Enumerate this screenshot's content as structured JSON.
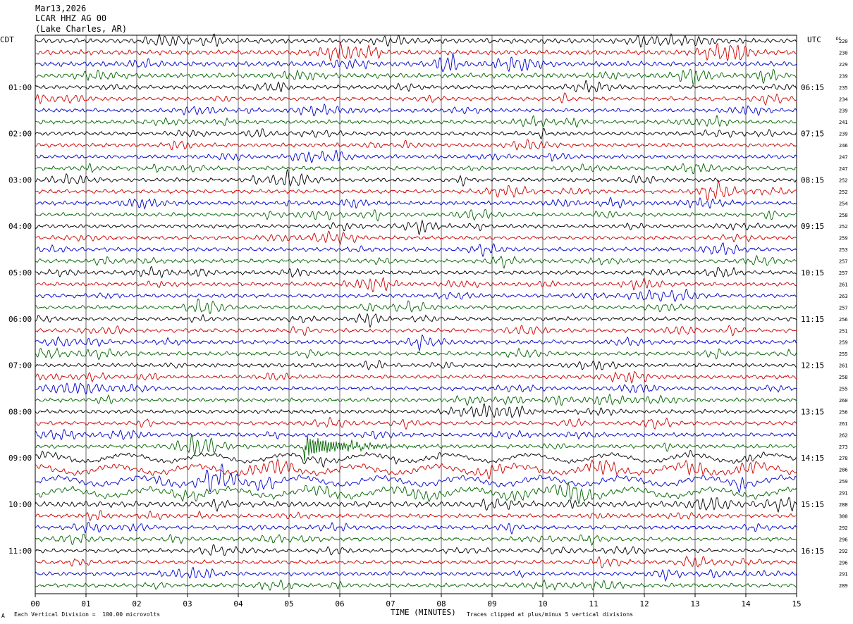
{
  "header": {
    "date": "Mar13,2026",
    "station": "LCAR HHZ AG 00",
    "location": "(Lake Charles, AR)"
  },
  "left_tz": "CDT",
  "right_tz": "UTC",
  "dc_label": "DC",
  "footer": {
    "scale_note": "Each Vertical Division =  100.00 microvolts",
    "clip_note": "Traces clipped at plus/minus 5 vertical divisions",
    "corner_mark": "A"
  },
  "chart_data": {
    "type": "line",
    "title": "",
    "xlabel": "TIME (MINUTES)",
    "ylabel": "",
    "xlim": [
      0,
      15
    ],
    "x_ticks": [
      "00",
      "01",
      "02",
      "03",
      "04",
      "05",
      "06",
      "07",
      "08",
      "09",
      "10",
      "11",
      "12",
      "13",
      "14",
      "15"
    ],
    "rows_per_hour": 4,
    "trace_colors": [
      "#000000",
      "#cc0000",
      "#0000cc",
      "#006400"
    ],
    "left_hour_labels": [
      "01:00",
      "02:00",
      "03:00",
      "04:00",
      "05:00",
      "06:00",
      "07:00",
      "08:00",
      "09:00",
      "10:00",
      "11:00"
    ],
    "right_hour_labels": [
      "06:15",
      "07:15",
      "08:15",
      "09:15",
      "10:15",
      "11:15",
      "12:15",
      "13:15",
      "14:15",
      "15:15",
      "16:15"
    ],
    "dc_offsets": [
      220,
      230,
      229,
      239,
      235,
      234,
      239,
      241,
      239,
      246,
      247,
      247,
      252,
      252,
      254,
      258,
      252,
      259,
      253,
      257,
      257,
      261,
      263,
      257,
      256,
      251,
      259,
      255,
      261,
      258,
      255,
      260,
      256,
      261,
      262,
      273,
      278,
      286,
      259,
      291,
      288,
      300,
      292,
      296,
      292,
      296,
      291,
      289
    ],
    "event": {
      "row": 35,
      "minute": 5.3,
      "description_minutes": [
        5.3,
        7.5
      ]
    }
  }
}
